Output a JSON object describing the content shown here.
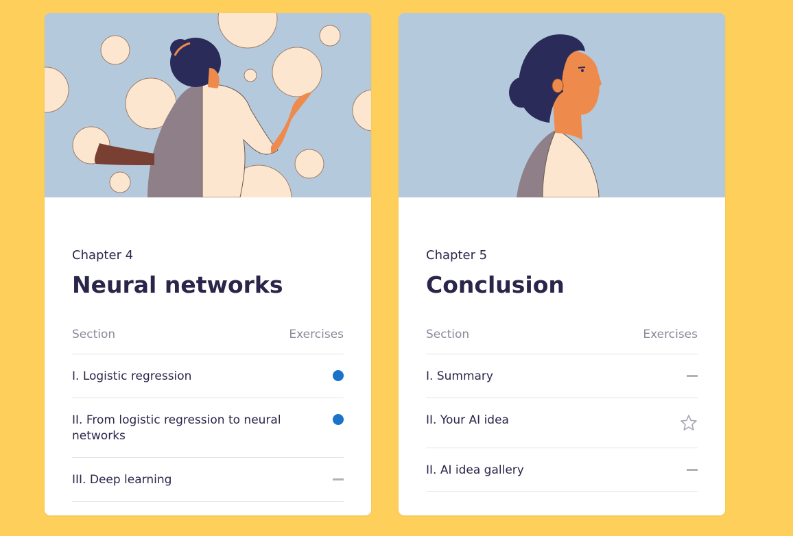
{
  "chapters": [
    {
      "label": "Chapter 4",
      "title": "Neural networks",
      "section_header": "Section",
      "exercises_header": "Exercises",
      "sections": [
        {
          "title": "I. Logistic regression",
          "status": "in-progress-dot"
        },
        {
          "title": "II. From logistic regression to neural networks",
          "status": "in-progress-dot"
        },
        {
          "title": "III. Deep learning",
          "status": "no-exercises-dash"
        }
      ]
    },
    {
      "label": "Chapter 5",
      "title": "Conclusion",
      "section_header": "Section",
      "exercises_header": "Exercises",
      "sections": [
        {
          "title": "I. Summary",
          "status": "no-exercises-dash"
        },
        {
          "title": "II. Your AI idea",
          "status": "star-outline"
        },
        {
          "title": "II. AI idea gallery",
          "status": "no-exercises-dash"
        }
      ]
    }
  ],
  "colors": {
    "page_background": "#fed05b",
    "hero_background": "#b5c9dd",
    "dot": "#1a73c8",
    "dash": "#b0b0b8",
    "text": "#29264a",
    "muted_text": "#8a8a9a"
  }
}
